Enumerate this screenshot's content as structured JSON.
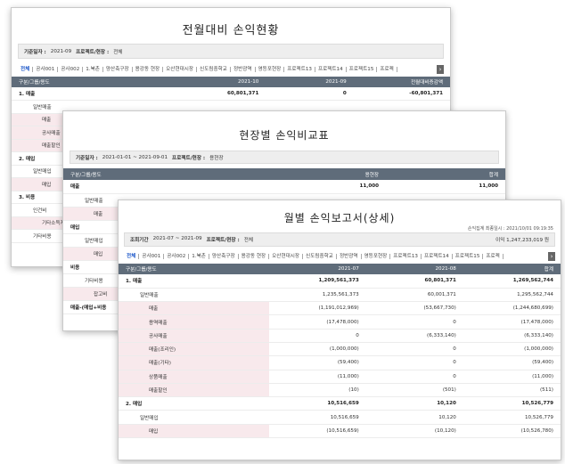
{
  "card1": {
    "title": "전월대비 손익현황",
    "cond_label": "기준일자 :",
    "cond_date": "2021-09",
    "cond_proj_label": "프로젝트/현장 :",
    "cond_proj": "전체",
    "tabs": [
      "전체",
      "공사001",
      "공사002",
      "1.북촌",
      "양산축구장",
      "용강동 현장",
      "오산현대시장",
      "신도림중학교",
      "정반광역",
      "영등포현장",
      "프로젝트13",
      "프로젝트14",
      "프로젝트15",
      "프로젝"
    ],
    "headers": [
      "구분/그룹/용도",
      "2021-10",
      "2021-09",
      "전월대비증감액"
    ],
    "rows": [
      {
        "label": "1. 매출",
        "v1": "60,801,371",
        "v2": "0",
        "v3": "-60,801,371"
      },
      {
        "label": "일반매출",
        "v1": "",
        "v2": "",
        "v3": ""
      },
      {
        "label": "매출",
        "v1": "",
        "v2": "",
        "v3": ""
      },
      {
        "label": "공사매출",
        "v1": "",
        "v2": "",
        "v3": ""
      },
      {
        "label": "매출할인",
        "v1": "",
        "v2": "",
        "v3": ""
      },
      {
        "label": "2. 매입",
        "v1": "",
        "v2": "",
        "v3": ""
      },
      {
        "label": "일반매입",
        "v1": "",
        "v2": "",
        "v3": ""
      },
      {
        "label": "매입",
        "v1": "",
        "v2": "",
        "v3": ""
      },
      {
        "label": "3. 비용",
        "v1": "",
        "v2": "",
        "v3": ""
      },
      {
        "label": "인건비",
        "v1": "",
        "v2": "",
        "v3": ""
      },
      {
        "label": "기타소득지",
        "v1": "",
        "v2": "",
        "v3": ""
      },
      {
        "label": "기타비용",
        "v1": "",
        "v2": "",
        "v3": ""
      }
    ]
  },
  "card2": {
    "title": "현장별 손익비교표",
    "cond_label": "기준일자 :",
    "cond_date": "2021-01-01 ~ 2021-09-01",
    "cond_proj_label": "프로젝트/현장 :",
    "cond_proj": "용현장",
    "headers": [
      "구분/그룹/용도",
      "용현장",
      "합계"
    ],
    "rows": [
      {
        "label": "매출",
        "v1": "11,000",
        "v2": "11,000"
      },
      {
        "label": "일반매출",
        "v1": "",
        "v2": ""
      },
      {
        "label": "매출",
        "v1": "",
        "v2": ""
      },
      {
        "label": "매입",
        "v1": "",
        "v2": ""
      },
      {
        "label": "일반매입",
        "v1": "",
        "v2": ""
      },
      {
        "label": "매입",
        "v1": "",
        "v2": ""
      },
      {
        "label": "비용",
        "v1": "",
        "v2": ""
      },
      {
        "label": "기타비용",
        "v1": "",
        "v2": ""
      },
      {
        "label": "잡고비",
        "v1": "",
        "v2": ""
      },
      {
        "label": "매출-(매입+비용",
        "v1": "",
        "v2": ""
      }
    ]
  },
  "card3": {
    "title": "월별 손익보고서(상세)",
    "stamp": "손익집계 최종일시 : 2021/10/01 09:19:35",
    "cond_label": "조회기간",
    "cond_date": "2021-07 ~ 2021-09",
    "cond_proj_label": "프로젝트/현장 :",
    "cond_proj": "전체",
    "profit": "이익 1,247,233,019 원",
    "tabs": [
      "전체",
      "공사001",
      "공사002",
      "1.북촌",
      "양산축구장",
      "용강동 현장",
      "오산현대시장",
      "신도림중학교",
      "정반광역",
      "영등포현장",
      "프로젝트13",
      "프로젝트14",
      "프로젝트15",
      "프로젝"
    ],
    "headers": [
      "구분/그룹/용도",
      "2021-07",
      "2021-08",
      "합계"
    ],
    "rows": [
      {
        "label": "1. 매출",
        "v1": "1,209,561,373",
        "v2": "60,801,371",
        "v3": "1,269,562,744"
      },
      {
        "label": "일반매출",
        "v1": "1,235,561,373",
        "v2": "60,001,371",
        "v3": "1,295,562,744"
      },
      {
        "label": "매출",
        "v1": "(1,191,012,969)",
        "v2": "(53,667,730)",
        "v3": "(1,244,680,699)"
      },
      {
        "label": "용역매출",
        "v1": "(17,478,000)",
        "v2": "0",
        "v3": "(17,478,000)"
      },
      {
        "label": "공사매출",
        "v1": "0",
        "v2": "(6,333,140)",
        "v3": "(6,333,140)"
      },
      {
        "label": "매출(조리인)",
        "v1": "(1,000,000)",
        "v2": "0",
        "v3": "(1,000,000)"
      },
      {
        "label": "매출(기타)",
        "v1": "(59,400)",
        "v2": "0",
        "v3": "(59,400)"
      },
      {
        "label": "상품매출",
        "v1": "(11,000)",
        "v2": "0",
        "v3": "(11,000)"
      },
      {
        "label": "매출할인",
        "v1": "(10)",
        "v2": "(501)",
        "v3": "(511)"
      },
      {
        "label": "2. 매입",
        "v1": "10,516,659",
        "v2": "10,120",
        "v3": "10,526,779"
      },
      {
        "label": "일반매입",
        "v1": "10,516,659",
        "v2": "10,120",
        "v3": "10,526,779"
      },
      {
        "label": "매입",
        "v1": "(10,516,659)",
        "v2": "(10,120)",
        "v3": "(10,526,780)"
      }
    ]
  }
}
